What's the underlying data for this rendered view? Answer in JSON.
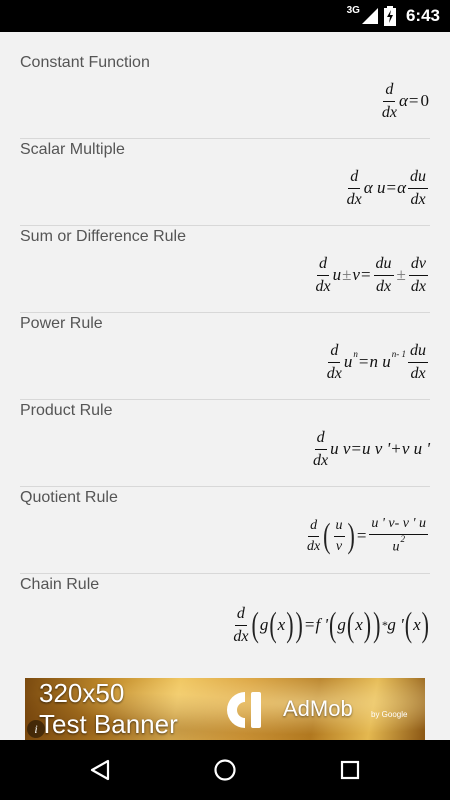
{
  "status_bar": {
    "network": "3G",
    "time": "6:43",
    "icons": [
      "signal-icon",
      "battery-charging-icon"
    ]
  },
  "rules": [
    {
      "title": "Constant Function"
    },
    {
      "title": "Scalar Multiple"
    },
    {
      "title": "Sum or Difference Rule"
    },
    {
      "title": "Power Rule"
    },
    {
      "title": "Product Rule"
    },
    {
      "title": "Quotient Rule"
    },
    {
      "title": "Chain Rule"
    }
  ],
  "ad": {
    "line1": "320x50",
    "line2": "Test Banner",
    "brand": "AdMob",
    "by": "by Google",
    "info": "i"
  },
  "nav": {
    "icons": [
      "back-icon",
      "home-icon",
      "recents-icon"
    ]
  },
  "colors": {
    "background": "#f2f2f2",
    "title_text": "#555555",
    "bars": "#000000"
  }
}
